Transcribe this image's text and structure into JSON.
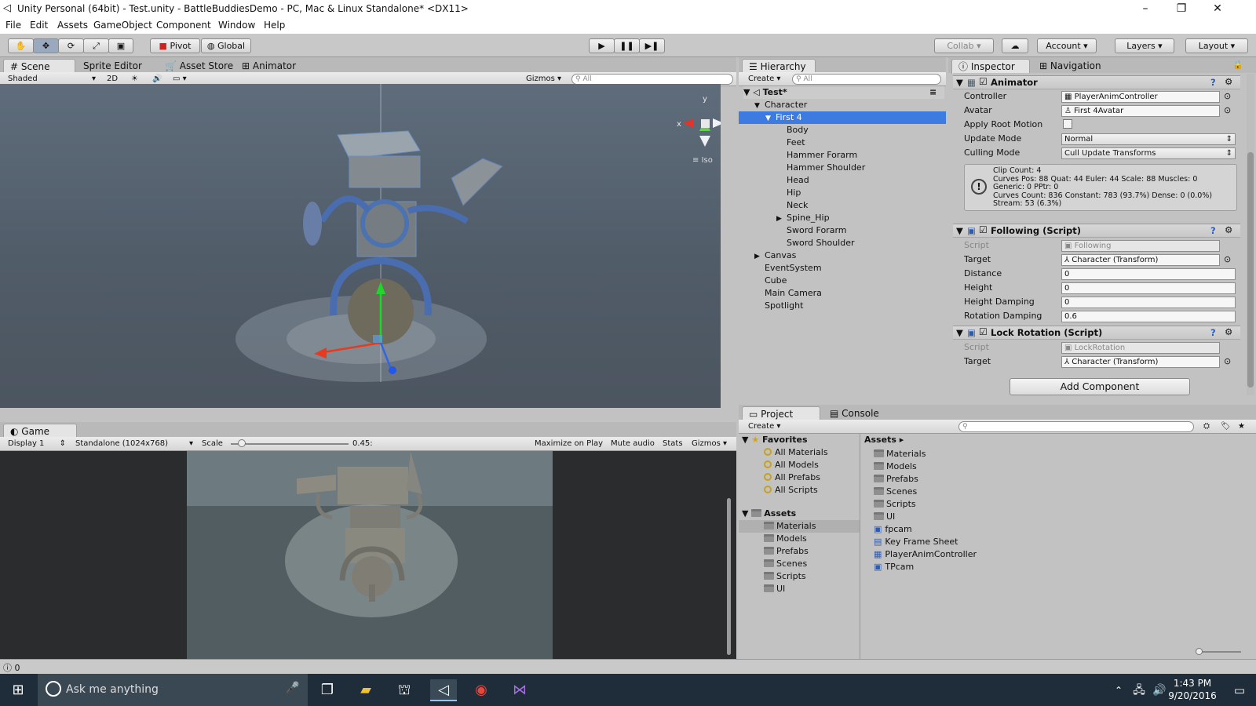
{
  "window": {
    "title": "Unity Personal (64bit) - Test.unity - BattleBuddiesDemo - PC, Mac & Linux Standalone* <DX11>",
    "unity_icon": "unity-logo-icon",
    "minimize": "–",
    "restore": "❐",
    "close": "✕"
  },
  "menu": [
    "File",
    "Edit",
    "Assets",
    "GameObject",
    "Component",
    "Window",
    "Help"
  ],
  "toolbar": {
    "pivot": "Pivot",
    "global": "Global",
    "collab": "Collab",
    "account": "Account",
    "layers": "Layers",
    "layout": "Layout"
  },
  "scene": {
    "tabs": [
      "Scene",
      "Sprite Editor",
      "Asset Store",
      "Animator"
    ],
    "shading": "Shaded",
    "mode_2d": "2D",
    "gizmos": "Gizmos",
    "search_placeholder": "All",
    "iso": "Iso",
    "axis_x": "x",
    "axis_y": "y"
  },
  "game": {
    "tab": "Game",
    "display": "Display 1",
    "resolution": "Standalone (1024x768)",
    "scale_label": "Scale",
    "scale_value": "0.45:",
    "maximize": "Maximize on Play",
    "mute": "Mute audio",
    "stats": "Stats",
    "gizmos": "Gizmos"
  },
  "hierarchy": {
    "tab": "Hierarchy",
    "create": "Create",
    "search_placeholder": "All",
    "scene": "Test*",
    "items": [
      {
        "label": "Character",
        "depth": 1,
        "arrow": "▼"
      },
      {
        "label": "First 4",
        "depth": 2,
        "arrow": "▼",
        "selected": true
      },
      {
        "label": "Body",
        "depth": 3,
        "arrow": ""
      },
      {
        "label": "Feet",
        "depth": 3,
        "arrow": ""
      },
      {
        "label": "Hammer Forarm",
        "depth": 3,
        "arrow": ""
      },
      {
        "label": "Hammer Shoulder",
        "depth": 3,
        "arrow": ""
      },
      {
        "label": "Head",
        "depth": 3,
        "arrow": ""
      },
      {
        "label": "Hip",
        "depth": 3,
        "arrow": ""
      },
      {
        "label": "Neck",
        "depth": 3,
        "arrow": ""
      },
      {
        "label": "Spine_Hip",
        "depth": 3,
        "arrow": "▶"
      },
      {
        "label": "Sword Forarm",
        "depth": 3,
        "arrow": ""
      },
      {
        "label": "Sword Shoulder",
        "depth": 3,
        "arrow": ""
      },
      {
        "label": "Canvas",
        "depth": 1,
        "arrow": "▶"
      },
      {
        "label": "EventSystem",
        "depth": 1,
        "arrow": ""
      },
      {
        "label": "Cube",
        "depth": 1,
        "arrow": ""
      },
      {
        "label": "Main Camera",
        "depth": 1,
        "arrow": ""
      },
      {
        "label": "Spotlight",
        "depth": 1,
        "arrow": ""
      }
    ]
  },
  "inspector": {
    "tab": "Inspector",
    "nav_tab": "Navigation",
    "animator": {
      "title": "Animator",
      "controller_label": "Controller",
      "controller": "PlayerAnimController",
      "avatar_label": "Avatar",
      "avatar": "First 4Avatar",
      "root_motion_label": "Apply Root Motion",
      "update_mode_label": "Update Mode",
      "update_mode": "Normal",
      "culling_label": "Culling Mode",
      "culling": "Cull Update Transforms",
      "info": [
        "Clip Count: 4",
        "Curves Pos: 88 Quat: 44 Euler: 44 Scale: 88 Muscles: 0",
        "Generic: 0 PPtr: 0",
        "Curves Count: 836 Constant: 783 (93.7%) Dense: 0 (0.0%)",
        "Stream: 53 (6.3%)"
      ]
    },
    "following": {
      "title": "Following (Script)",
      "script_label": "Script",
      "script": "Following",
      "target_label": "Target",
      "target": "Character (Transform)",
      "distance_label": "Distance",
      "distance": "0",
      "height_label": "Height",
      "height": "0",
      "hdamp_label": "Height Damping",
      "hdamp": "0",
      "rdamp_label": "Rotation Damping",
      "rdamp": "0.6"
    },
    "lock": {
      "title": "Lock Rotation (Script)",
      "script_label": "Script",
      "script": "LockRotation",
      "target_label": "Target",
      "target": "Character (Transform)"
    },
    "add_component": "Add Component"
  },
  "project": {
    "tab": "Project",
    "console_tab": "Console",
    "create": "Create",
    "favorites_label": "Favorites",
    "favorites": [
      "All Materials",
      "All Models",
      "All Prefabs",
      "All Scripts"
    ],
    "assets_label": "Assets",
    "tree": [
      "Materials",
      "Models",
      "Prefabs",
      "Scenes",
      "Scripts",
      "UI"
    ],
    "breadcrumb": "Assets ▸",
    "files": [
      {
        "name": "Materials",
        "icon": "folder-icon"
      },
      {
        "name": "Models",
        "icon": "folder-icon"
      },
      {
        "name": "Prefabs",
        "icon": "folder-icon"
      },
      {
        "name": "Scenes",
        "icon": "folder-icon"
      },
      {
        "name": "Scripts",
        "icon": "folder-icon"
      },
      {
        "name": "UI",
        "icon": "folder-icon"
      },
      {
        "name": "fpcam",
        "icon": "script-icon"
      },
      {
        "name": "Key Frame Sheet",
        "icon": "document-icon"
      },
      {
        "name": "PlayerAnimController",
        "icon": "animator-controller-icon"
      },
      {
        "name": "TPcam",
        "icon": "script-icon"
      }
    ]
  },
  "status": {
    "count": "0"
  },
  "taskbar": {
    "search_placeholder": "Ask me anything",
    "time": "1:43 PM",
    "date": "9/20/2016"
  }
}
